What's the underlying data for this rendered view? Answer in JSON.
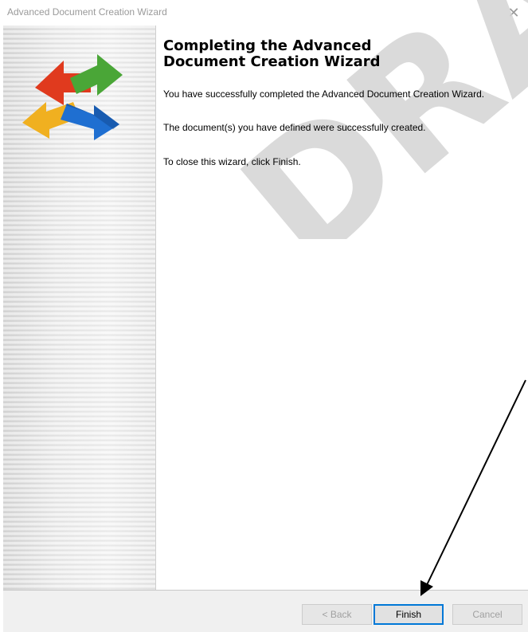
{
  "window": {
    "title": "Advanced Document Creation Wizard",
    "close_glyph": "✕"
  },
  "sidebar": {
    "logo_icon": "four-arrows-logo-icon"
  },
  "content": {
    "heading_line1": "Completing the Advanced",
    "heading_line2": "Document Creation Wizard",
    "paragraph1": "You have successfully completed the Advanced Document Creation Wizard.",
    "paragraph2": "The document(s) you have defined were successfully created.",
    "paragraph3": "To close this wizard, click Finish."
  },
  "watermark": {
    "text": "DRAFT"
  },
  "footer": {
    "back_label": "< Back",
    "finish_label": "Finish",
    "cancel_label": "Cancel"
  },
  "colors": {
    "accent": "#0078d7",
    "watermark": "#cccccc"
  }
}
